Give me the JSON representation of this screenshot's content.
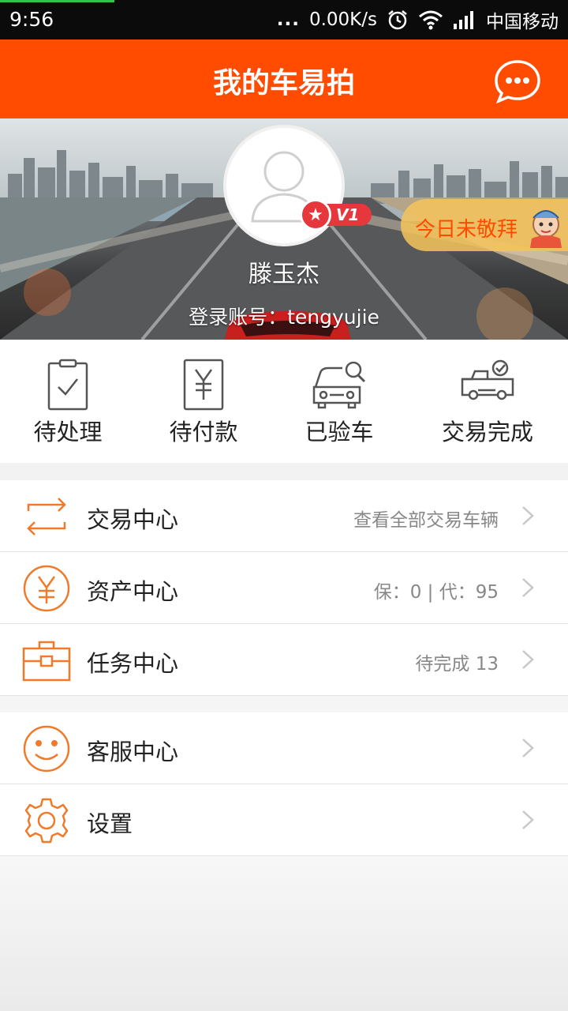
{
  "status_bar": {
    "time": "9:56",
    "more": "...",
    "speed": "0.00K/s",
    "carrier": "中国移动",
    "icons": [
      "alarm-icon",
      "wifi-icon",
      "signal-icon"
    ]
  },
  "header": {
    "title": "我的车易拍",
    "message_icon": "chat-bubble-icon"
  },
  "profile": {
    "name": "滕玉杰",
    "account": "登录账号：tengyujie",
    "vip_level": "V1",
    "worship_label": "今日未敬拜"
  },
  "quick_actions": [
    {
      "label": "待处理",
      "icon": "clipboard-check-icon"
    },
    {
      "label": "待付款",
      "icon": "yuan-receipt-icon"
    },
    {
      "label": "已验车",
      "icon": "car-search-icon"
    },
    {
      "label": "交易完成",
      "icon": "truck-check-icon"
    }
  ],
  "menu": {
    "trade": {
      "label": "交易中心",
      "extra": "查看全部交易车辆",
      "icon": "exchange-arrows-icon"
    },
    "assets": {
      "label": "资产中心",
      "extra": "保：0 | 代：95",
      "icon": "yuan-circle-icon"
    },
    "tasks": {
      "label": "任务中心",
      "extra": "待完成  13",
      "icon": "briefcase-icon"
    },
    "service": {
      "label": "客服中心",
      "icon": "smiley-icon"
    },
    "settings": {
      "label": "设置",
      "icon": "gear-icon"
    }
  },
  "colors": {
    "brand": "#ff4c00",
    "icon_orange": "#f07a2a",
    "vip_red": "#e6383c"
  }
}
